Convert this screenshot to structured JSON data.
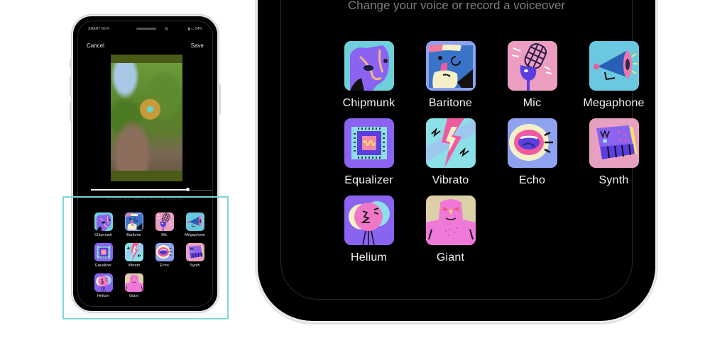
{
  "small_phone": {
    "status_bar": {
      "carrier": "SMART Wi-Fi",
      "battery": "54%"
    },
    "nav": {
      "cancel_label": "Cancel",
      "save_label": "Save"
    },
    "scrubber": {
      "progress_percent": 80
    },
    "subtitle": "Change your voice or record a voiceover"
  },
  "large_phone": {
    "subtitle": "Change your voice or record a voiceover"
  },
  "effects": [
    {
      "label": "Chipmunk",
      "icon": "chipmunk-icon"
    },
    {
      "label": "Baritone",
      "icon": "baritone-icon"
    },
    {
      "label": "Mic",
      "icon": "mic-icon"
    },
    {
      "label": "Megaphone",
      "icon": "megaphone-icon"
    },
    {
      "label": "Equalizer",
      "icon": "equalizer-icon"
    },
    {
      "label": "Vibrato",
      "icon": "vibrato-icon"
    },
    {
      "label": "Echo",
      "icon": "echo-icon"
    },
    {
      "label": "Synth",
      "icon": "synth-icon"
    },
    {
      "label": "Helium",
      "icon": "helium-icon"
    },
    {
      "label": "Giant",
      "icon": "giant-icon"
    }
  ],
  "colors": {
    "highlight": "#7fd6d4",
    "background": "#000000",
    "label": "#f2f2f2",
    "subtitle": "#7e7e7e"
  }
}
